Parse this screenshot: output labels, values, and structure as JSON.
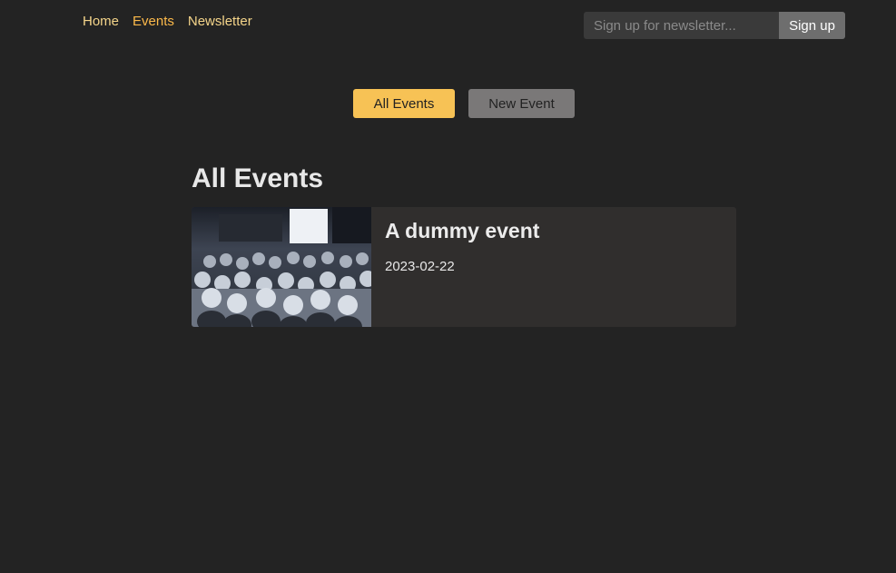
{
  "nav": {
    "links": [
      {
        "label": "Home"
      },
      {
        "label": "Events"
      },
      {
        "label": "Newsletter"
      }
    ]
  },
  "newsletter": {
    "placeholder": "Sign up for newsletter...",
    "button_label": "Sign up"
  },
  "actions": {
    "all_events_label": "All Events",
    "new_event_label": "New Event"
  },
  "page": {
    "title": "All Events"
  },
  "events": [
    {
      "title": "A dummy event",
      "date": "2023-02-22",
      "image": "audience-photo"
    }
  ],
  "colors": {
    "background": "#232323",
    "accent": "#f7c255",
    "nav_link": "#f5d58a",
    "nav_active": "#fcb94a",
    "card": "#302e2d"
  }
}
